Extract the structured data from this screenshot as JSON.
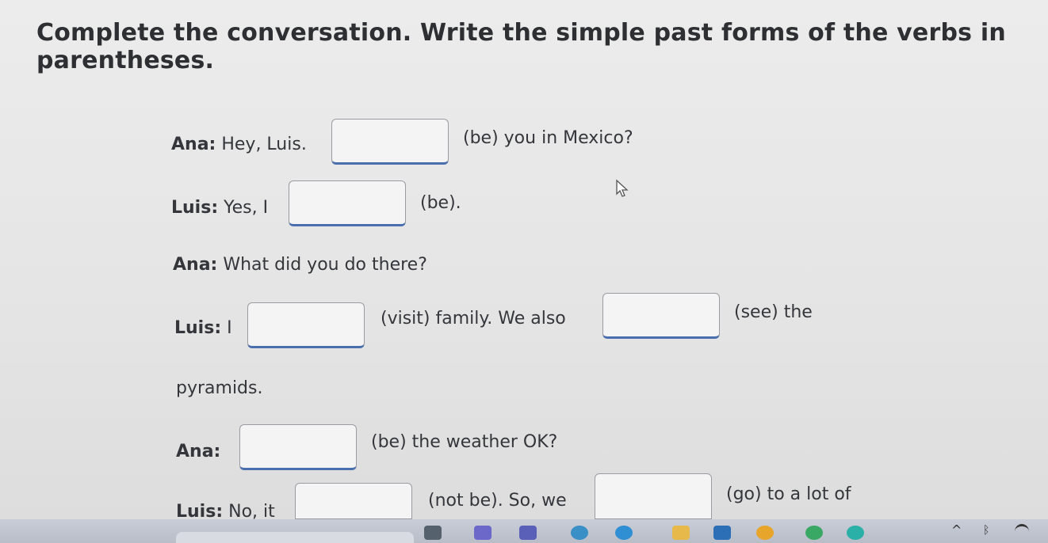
{
  "instruction": "Complete the conversation. Write the simple past forms of the verbs in parentheses.",
  "lines": [
    {
      "speaker": "Ana:",
      "before": "Hey, Luis.",
      "after": "(be) you in Mexico?"
    },
    {
      "speaker": "Luis:",
      "before": "Yes, I",
      "after": "(be)."
    },
    {
      "speaker": "Ana:",
      "text": "What did you do there?"
    },
    {
      "speaker": "Luis:",
      "before": "I",
      "middle": "(visit) family. We also",
      "after": "(see) the"
    },
    {
      "text": "pyramids."
    },
    {
      "speaker": "Ana:",
      "after": "(be) the weather OK?"
    },
    {
      "speaker": "Luis:",
      "before": "No, it",
      "middle": "(not be). So, we",
      "after": "(go) to a lot of"
    }
  ],
  "colors": {
    "text": "#34363b",
    "blank_underline": "#4a6fae",
    "taskbar": "#c4c8d2"
  },
  "taskbar_icons": [
    "file-explorer-icon",
    "teams-icon",
    "search-icon",
    "edge-icon",
    "folder-icon",
    "outlook-icon",
    "chrome-icon",
    "photos-icon",
    "edge-dev-icon",
    "chevron-up-icon",
    "bluetooth-icon",
    "wifi-icon"
  ]
}
